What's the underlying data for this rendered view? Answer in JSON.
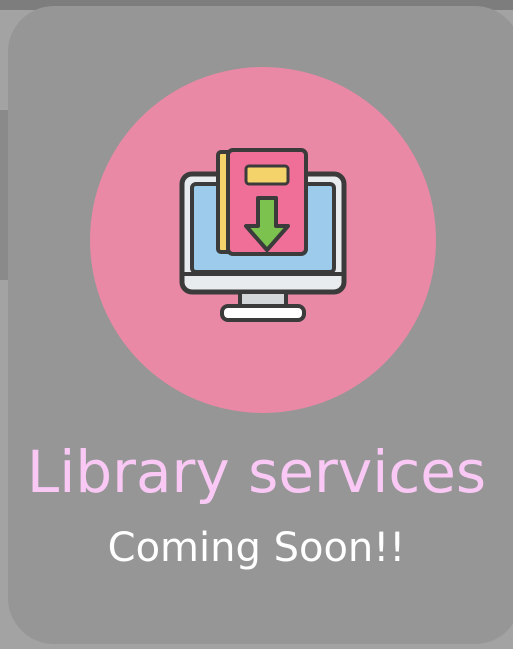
{
  "tile": {
    "title": "Library services",
    "subtitle": "Coming Soon!!",
    "icon": "computer-book-download-icon"
  },
  "colors": {
    "background": "#a3a3a3",
    "card": "#969696",
    "circle": "#ea89a5",
    "title": "#f9c8f5",
    "subtitle": "#ffffff"
  }
}
